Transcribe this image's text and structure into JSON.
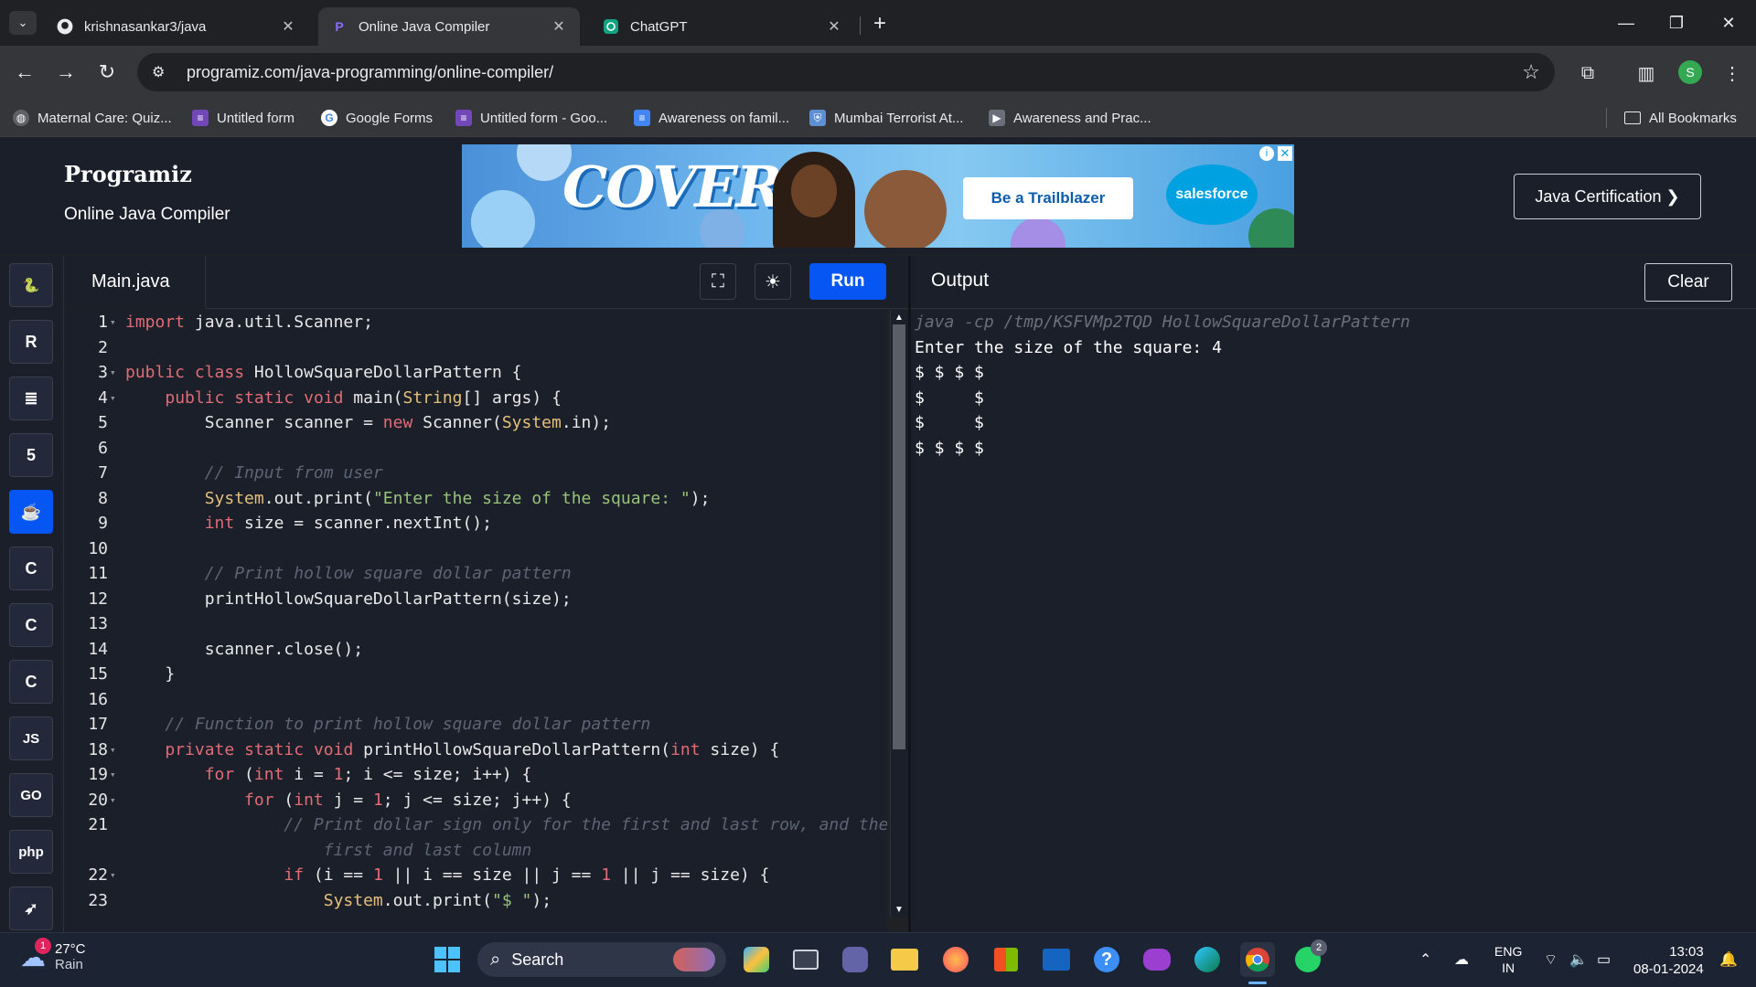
{
  "browser": {
    "tab_list_icon": "chevron-down-icon",
    "tabs": [
      {
        "label": "krishnasankar3/java",
        "icon": "github-icon"
      },
      {
        "label": "Online Java Compiler",
        "icon": "programiz-icon"
      },
      {
        "label": "ChatGPT",
        "icon": "chatgpt-icon"
      }
    ],
    "close_glyph": "✕",
    "new_tab_glyph": "+",
    "url": "programiz.com/java-programming/online-compiler/",
    "profile_initial": "S",
    "bookmarks": [
      {
        "label": "Maternal Care: Quiz...",
        "icon": "globe-icon",
        "color": "#5f6368"
      },
      {
        "label": "Untitled form",
        "icon": "forms-icon",
        "color": "#7248b9"
      },
      {
        "label": "Google Forms",
        "icon": "google-icon",
        "color": "#ffffff"
      },
      {
        "label": "Untitled form - Goo...",
        "icon": "forms-icon",
        "color": "#7248b9"
      },
      {
        "label": "Awareness on famil...",
        "icon": "docs-icon",
        "color": "#4285f4"
      },
      {
        "label": "Mumbai Terrorist At...",
        "icon": "shield-icon",
        "color": "#5f8fd3"
      },
      {
        "label": "Awareness and Prac...",
        "icon": "slides-icon",
        "color": "#6b6f7a"
      }
    ],
    "all_bookmarks": "All Bookmarks"
  },
  "site": {
    "logo": "Programiz",
    "subtitle": "Online Java Compiler",
    "ad_cover_text": "COVER",
    "ad_button": "Be a Trailblazer",
    "ad_brand": "salesforce",
    "cert_button": "Java Certification ❯"
  },
  "sidebar": {
    "languages": [
      {
        "name": "python",
        "glyph": "🐍",
        "active": false
      },
      {
        "name": "r",
        "glyph": "R",
        "active": false
      },
      {
        "name": "sql",
        "glyph": "≣",
        "active": false
      },
      {
        "name": "html",
        "glyph": "5",
        "active": false
      },
      {
        "name": "java",
        "glyph": "☕",
        "active": true
      },
      {
        "name": "c",
        "glyph": "C",
        "active": false
      },
      {
        "name": "cpp",
        "glyph": "C",
        "active": false
      },
      {
        "name": "csharp",
        "glyph": "C",
        "active": false
      },
      {
        "name": "js",
        "glyph": "JS",
        "active": false
      },
      {
        "name": "go",
        "glyph": "GO",
        "active": false
      },
      {
        "name": "php",
        "glyph": "php",
        "active": false
      },
      {
        "name": "swift",
        "glyph": "➶",
        "active": false
      }
    ]
  },
  "editor": {
    "file_tab": "Main.java",
    "run_label": "Run",
    "lines": [
      {
        "n": "1",
        "fold": true,
        "html": "<span class=\"kw\">import</span> java.util.Scanner;"
      },
      {
        "n": "2",
        "fold": false,
        "html": ""
      },
      {
        "n": "3",
        "fold": true,
        "html": "<span class=\"kw\">public</span> <span class=\"kw\">class</span> HollowSquareDollarPattern {"
      },
      {
        "n": "4",
        "fold": true,
        "html": "    <span class=\"kw\">public</span> <span class=\"kw\">static</span> <span class=\"kw\">void</span> main(<span class=\"typ\">String</span>[] args) {"
      },
      {
        "n": "5",
        "fold": false,
        "html": "        Scanner scanner = <span class=\"kw\">new</span> Scanner(<span class=\"typ\">System</span>.in);"
      },
      {
        "n": "6",
        "fold": false,
        "html": ""
      },
      {
        "n": "7",
        "fold": false,
        "html": "        <span class=\"cm\">// Input from user</span>"
      },
      {
        "n": "8",
        "fold": false,
        "html": "        <span class=\"typ\">System</span>.out.print(<span class=\"str\">\"Enter the size of the square: \"</span>);"
      },
      {
        "n": "9",
        "fold": false,
        "html": "        <span class=\"kw\">int</span> size = scanner.nextInt();"
      },
      {
        "n": "10",
        "fold": false,
        "html": ""
      },
      {
        "n": "11",
        "fold": false,
        "html": "        <span class=\"cm\">// Print hollow square dollar pattern</span>"
      },
      {
        "n": "12",
        "fold": false,
        "html": "        printHollowSquareDollarPattern(size);"
      },
      {
        "n": "13",
        "fold": false,
        "html": ""
      },
      {
        "n": "14",
        "fold": false,
        "html": "        scanner.close();"
      },
      {
        "n": "15",
        "fold": false,
        "html": "    }"
      },
      {
        "n": "16",
        "fold": false,
        "html": ""
      },
      {
        "n": "17",
        "fold": false,
        "html": "    <span class=\"cm\">// Function to print hollow square dollar pattern</span>"
      },
      {
        "n": "18",
        "fold": true,
        "html": "    <span class=\"kw\">private</span> <span class=\"kw\">static</span> <span class=\"kw\">void</span> printHollowSquareDollarPattern(<span class=\"kw\">int</span> size) {"
      },
      {
        "n": "19",
        "fold": true,
        "html": "        <span class=\"kw\">for</span> (<span class=\"kw\">int</span> i = <span class=\"num\">1</span>; i &lt;= size; i++) {"
      },
      {
        "n": "20",
        "fold": true,
        "html": "            <span class=\"kw\">for</span> (<span class=\"kw\">int</span> j = <span class=\"num\">1</span>; j &lt;= size; j++) {"
      },
      {
        "n": "21",
        "fold": false,
        "html": "                <span class=\"cm\">// Print dollar sign only for the first and last row, and the</span>"
      },
      {
        "n": "",
        "fold": false,
        "html": "                    <span class=\"cm\">first and last column</span>"
      },
      {
        "n": "22",
        "fold": true,
        "html": "                <span class=\"kw\">if</span> (i == <span class=\"num\">1</span> || i == size || j == <span class=\"num\">1</span> || j == size) {"
      },
      {
        "n": "23",
        "fold": false,
        "html": "                    <span class=\"typ\">System</span>.out.print(<span class=\"str\">\"$ \"</span>);"
      }
    ]
  },
  "output": {
    "title": "Output",
    "clear_label": "Clear",
    "command": "java -cp /tmp/KSFVMp2TQD HollowSquareDollarPattern",
    "lines": [
      "Enter the size of the square: 4",
      "$ $ $ $",
      "$     $",
      "$     $",
      "$ $ $ $"
    ]
  },
  "taskbar": {
    "temperature": "27°C",
    "weather_desc": "Rain",
    "weather_badge": "1",
    "search_placeholder": "Search",
    "language_line1": "ENG",
    "language_line2": "IN",
    "time": "13:03",
    "date": "08-01-2024",
    "whatsapp_badge": "2",
    "apps": [
      "windows-start-icon",
      "copilot-icon",
      "task-view-icon",
      "zoom-icon",
      "file-explorer-icon",
      "firefox-icon",
      "store-icon",
      "mylo-icon",
      "help-icon",
      "game-icon",
      "edge-icon",
      "chrome-icon",
      "whatsapp-icon"
    ]
  },
  "colors": {
    "accent": "#0556f3",
    "bg_dark": "#1b1f2a"
  }
}
